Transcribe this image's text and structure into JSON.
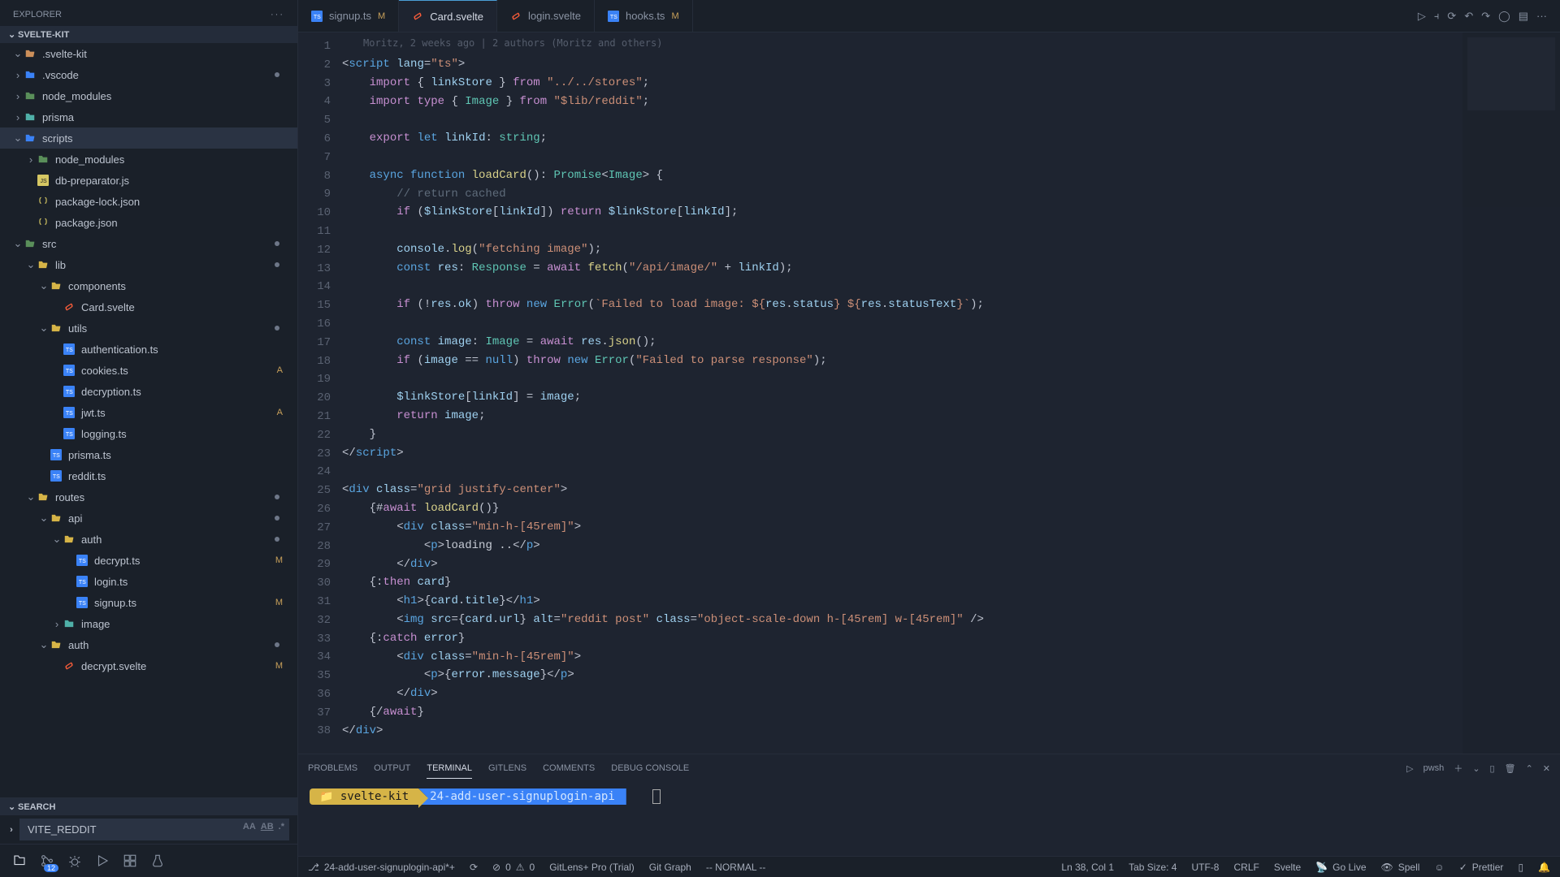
{
  "explorer": {
    "title": "EXPLORER",
    "project": "SVELTE-KIT",
    "search_title": "SEARCH",
    "search_value": "VITE_REDDIT",
    "search_opts": [
      "Aa",
      "ab",
      ".*"
    ],
    "tree": [
      {
        "depth": 0,
        "kind": "folder",
        "icon": "folder-open",
        "label": ".svelte-kit",
        "color": "#cc8f5a"
      },
      {
        "depth": 0,
        "kind": "folder",
        "icon": "folder",
        "label": ".vscode",
        "color": "#3a82f7",
        "dot": true
      },
      {
        "depth": 0,
        "kind": "folder",
        "icon": "folder",
        "label": "node_modules",
        "color": "#5a8f5a"
      },
      {
        "depth": 0,
        "kind": "folder",
        "icon": "folder",
        "label": "prisma",
        "color": "#4fb0a8"
      },
      {
        "depth": 0,
        "kind": "folder",
        "icon": "folder-open",
        "label": "scripts",
        "color": "#3a82f7",
        "selected": true
      },
      {
        "depth": 1,
        "kind": "folder",
        "icon": "folder",
        "label": "node_modules",
        "color": "#5a8f5a"
      },
      {
        "depth": 1,
        "kind": "file",
        "icon": "js",
        "label": "db-preparator.js"
      },
      {
        "depth": 1,
        "kind": "file",
        "icon": "json",
        "label": "package-lock.json"
      },
      {
        "depth": 1,
        "kind": "file",
        "icon": "json",
        "label": "package.json"
      },
      {
        "depth": 0,
        "kind": "folder",
        "icon": "folder-open",
        "label": "src",
        "color": "#5a8f5a",
        "dot": true
      },
      {
        "depth": 1,
        "kind": "folder",
        "icon": "folder-open",
        "label": "lib",
        "color": "#d6b447",
        "dot": true
      },
      {
        "depth": 2,
        "kind": "folder",
        "icon": "folder-open",
        "label": "components",
        "color": "#d6b447"
      },
      {
        "depth": 3,
        "kind": "file",
        "icon": "svelte",
        "label": "Card.svelte"
      },
      {
        "depth": 2,
        "kind": "folder",
        "icon": "folder-open",
        "label": "utils",
        "color": "#d6b447",
        "dot": true
      },
      {
        "depth": 3,
        "kind": "file",
        "icon": "ts",
        "label": "authentication.ts"
      },
      {
        "depth": 3,
        "kind": "file",
        "icon": "ts",
        "label": "cookies.ts",
        "badge": "A"
      },
      {
        "depth": 3,
        "kind": "file",
        "icon": "ts",
        "label": "decryption.ts"
      },
      {
        "depth": 3,
        "kind": "file",
        "icon": "ts",
        "label": "jwt.ts",
        "badge": "A"
      },
      {
        "depth": 3,
        "kind": "file",
        "icon": "ts",
        "label": "logging.ts"
      },
      {
        "depth": 2,
        "kind": "file",
        "icon": "ts",
        "label": "prisma.ts"
      },
      {
        "depth": 2,
        "kind": "file",
        "icon": "ts",
        "label": "reddit.ts"
      },
      {
        "depth": 1,
        "kind": "folder",
        "icon": "folder-open",
        "label": "routes",
        "color": "#d6b447",
        "dot": true
      },
      {
        "depth": 2,
        "kind": "folder",
        "icon": "folder-open",
        "label": "api",
        "color": "#d6b447",
        "dot": true
      },
      {
        "depth": 3,
        "kind": "folder",
        "icon": "folder-open",
        "label": "auth",
        "color": "#d6b447",
        "dot": true
      },
      {
        "depth": 4,
        "kind": "file",
        "icon": "ts",
        "label": "decrypt.ts",
        "badge": "M"
      },
      {
        "depth": 4,
        "kind": "file",
        "icon": "ts",
        "label": "login.ts"
      },
      {
        "depth": 4,
        "kind": "file",
        "icon": "ts",
        "label": "signup.ts",
        "badge": "M"
      },
      {
        "depth": 3,
        "kind": "folder",
        "icon": "folder",
        "label": "image",
        "color": "#4fb0a8"
      },
      {
        "depth": 2,
        "kind": "folder",
        "icon": "folder-open",
        "label": "auth",
        "color": "#d6b447",
        "dot": true
      },
      {
        "depth": 3,
        "kind": "file",
        "icon": "svelte",
        "label": "decrypt.svelte",
        "badge": "M"
      }
    ]
  },
  "activity": {
    "scm_count": "12"
  },
  "tabs": [
    {
      "icon": "ts",
      "label": "signup.ts",
      "mod": "M",
      "active": false
    },
    {
      "icon": "svelte",
      "label": "Card.svelte",
      "mod": "",
      "active": true
    },
    {
      "icon": "svelte",
      "label": "login.svelte",
      "mod": "",
      "active": false
    },
    {
      "icon": "ts",
      "label": "hooks.ts",
      "mod": "M",
      "active": false
    }
  ],
  "blame": "Moritz, 2 weeks ago | 2 authors (Moritz and others)",
  "lines": 38,
  "panel": {
    "tabs": [
      "PROBLEMS",
      "OUTPUT",
      "TERMINAL",
      "GITLENS",
      "COMMENTS",
      "DEBUG CONSOLE"
    ],
    "active": "TERMINAL",
    "right_label": "pwsh",
    "prompt_cwd": "svelte-kit",
    "prompt_branch": "24-add-user-signuplogin-api"
  },
  "status": {
    "branch": "24-add-user-signuplogin-api*+",
    "errors": "0",
    "warnings": "0",
    "gitlens": "GitLens+ Pro (Trial)",
    "gitgraph": "Git Graph",
    "mode": "-- NORMAL --",
    "pos": "Ln 38, Col 1",
    "tabsize": "Tab Size: 4",
    "encoding": "UTF-8",
    "eol": "CRLF",
    "lang": "Svelte",
    "golive": "Go Live",
    "spell": "Spell",
    "prettier": "Prettier"
  }
}
